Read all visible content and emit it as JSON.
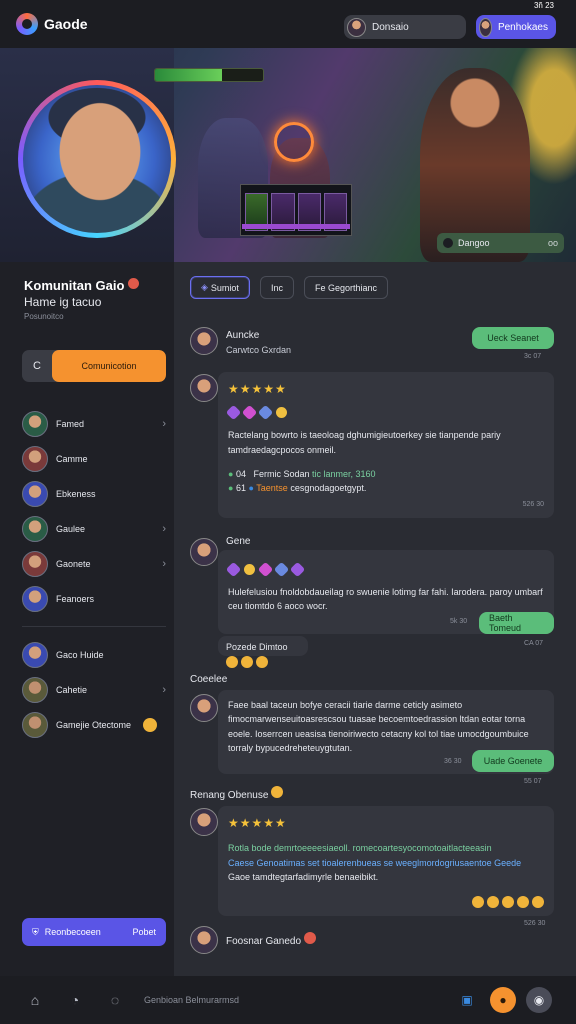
{
  "topbar": {
    "app_name": "Gaode",
    "user_label": "Donsaio",
    "profile_label": "Penhokaes",
    "top_badge": "3ñ 23"
  },
  "hero": {
    "tag_label": "Dangoo",
    "tag_right": "oo",
    "hp_fraction": 0.62
  },
  "sidebar": {
    "community_title": "Komunitan Gaio",
    "community_sub": "Hame ig tacuo",
    "community_meta": "Posunoitco",
    "join_left": "C",
    "join_right": "Comunicotion",
    "nav": [
      {
        "label": "Famed",
        "chevron": true
      },
      {
        "label": "Camme",
        "chevron": false
      },
      {
        "label": "Ebkeness",
        "chevron": false
      },
      {
        "label": "Gaulee",
        "chevron": true
      },
      {
        "label": "Gaonete",
        "chevron": true
      },
      {
        "label": "Feanoers",
        "chevron": false
      }
    ],
    "nav2": [
      {
        "label": "Gaco Huide",
        "chevron": false
      },
      {
        "label": "Cahetie",
        "chevron": true
      },
      {
        "label": "Gamejie Otectome",
        "chevron": false
      }
    ],
    "invite_label": "Reonbecoeen",
    "invite_right": "Pobet"
  },
  "main": {
    "tabs": [
      "Sumiot",
      "Inc",
      "Fe Gegorthianc"
    ],
    "posts": {
      "p1": {
        "name": "Auncke",
        "sub": "Carwtco Gxrdan",
        "chip": "Ueck Seanet",
        "time": "3c 07"
      },
      "p2": {
        "stars": "★★★★★",
        "text": "Ractelang bowrto is taeoloag dghumigieutoerkey sie tianpende pariy tamdraedagcpocos onmeil.",
        "line1_a": "04",
        "line1_b": "Fermic Sodan",
        "line1_c": "tic lanmer, 3160",
        "line2_a": "61",
        "line2_b": "Taentse",
        "line2_c": "cesgnodagoetgypt.",
        "time": "526 30"
      },
      "p3": {
        "name": "Gene",
        "text": "Hulefelusiou fnoldobdaueilag ro swuenie lotimg far fahi. Iarodera. paroy umbarf ceu tiomtdo 6 aoco wocr.",
        "chip": "Baeth Tomeud",
        "time": "5k 30",
        "time2": "CA 07"
      },
      "p4": {
        "name": "Pozede Dimtoo"
      },
      "p5": {
        "label": "Coeelee",
        "text": "Faee baal taceun bofye ceracii tiarie darme ceticly asimeto fimocmarwenseuitoasrescsou tuasae becoemtoedrassion ltdan eotar torna eoele. Ioserrcen ueasisa tienoiriwecto cetacny kol tol tiae umocdgoumbuice torraly bypucedreheteuygtutan.",
        "chip": "Uade Goenete",
        "time": "36 30",
        "time2": "55 07"
      },
      "p6": {
        "name": "Renang Obenuse",
        "stars": "★★★★★",
        "text_a": "Rotla bode demrtoeeeesiaeoll. romecoartesyocomotoaitlacteeasin",
        "text_b": "Caese Genoatimas set tioalerenbueas se weeglmordogriusaentoe Geede",
        "text_c": "Gaoe tamdtegtarfadimyrle benaeibikt.",
        "time": "526 30"
      },
      "p7": {
        "name": "Foosnar Ganedo"
      }
    }
  },
  "bottombar": {
    "status": "Genbioan Belmurarmsd"
  },
  "colors": {
    "accent": "#5a55e6",
    "orange": "#f5922f",
    "green": "#5bbd7a"
  }
}
